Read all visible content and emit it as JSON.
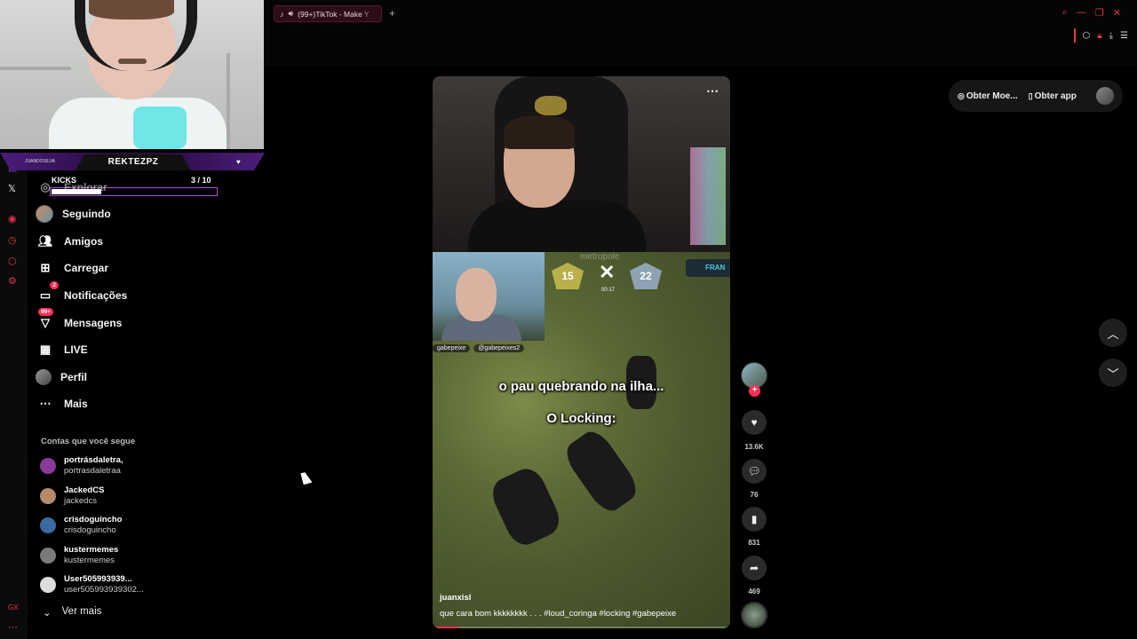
{
  "browser": {
    "tab_title": "(99+)TikTok - Make Y",
    "new_tab": "+"
  },
  "stream_overlay": {
    "streamer_name": "REKTEZPZ",
    "handle": "JUANDOSILVA",
    "kicks_label": "KICKS",
    "kicks_count": "3   / 10",
    "kicks_progress": 0.3
  },
  "nav": {
    "items": [
      {
        "label": "Explorar"
      },
      {
        "label": "Seguindo"
      },
      {
        "label": "Amigos"
      },
      {
        "label": "Carregar"
      },
      {
        "label": "Notificações",
        "badge": "2"
      },
      {
        "label": "Mensagens",
        "badge": "99+"
      },
      {
        "label": "LIVE"
      },
      {
        "label": "Perfil"
      },
      {
        "label": "Mais"
      }
    ]
  },
  "following": {
    "title": "Contas que você segue",
    "accounts": [
      {
        "name": "portrásdaletra,",
        "user": "portrasdaletraa",
        "color": "#8a3a9c"
      },
      {
        "name": "JackedCS",
        "user": "jackedcs",
        "color": "#b58a6a"
      },
      {
        "name": "crisdoguincho",
        "user": "crisdoguincho",
        "color": "#3a6aa0"
      },
      {
        "name": "kustermemes",
        "user": "kustermemes",
        "color": "#7a7a7a"
      },
      {
        "name": "User505993939...",
        "user": "user505993939302...",
        "color": "#dcdcdc"
      }
    ],
    "see_more": "Ver mais"
  },
  "video": {
    "tags_overlay": [
      "gabepeixe",
      "@gabepeixes2"
    ],
    "score_left": "15",
    "score_right": "22",
    "score_ghost": "metropole",
    "timer": "00:17",
    "team_label": "FRAN",
    "caption_1": "o pau quebrando na ilha...",
    "caption_2": "O Locking:",
    "author": "juanxisl",
    "description": "que cara bom kkkkkkkk . . . #loud_coringa  #locking  #gabepeixe",
    "progress": 0.09
  },
  "actions": {
    "likes": "13.6K",
    "comments": "76",
    "saves": "831",
    "shares": "469"
  },
  "header_right": {
    "coins_label": "Obter Moe...",
    "app_label": "Obter app"
  },
  "colors": {
    "accent": "#fe2c55",
    "overlay_purple": "#b04bd8"
  }
}
